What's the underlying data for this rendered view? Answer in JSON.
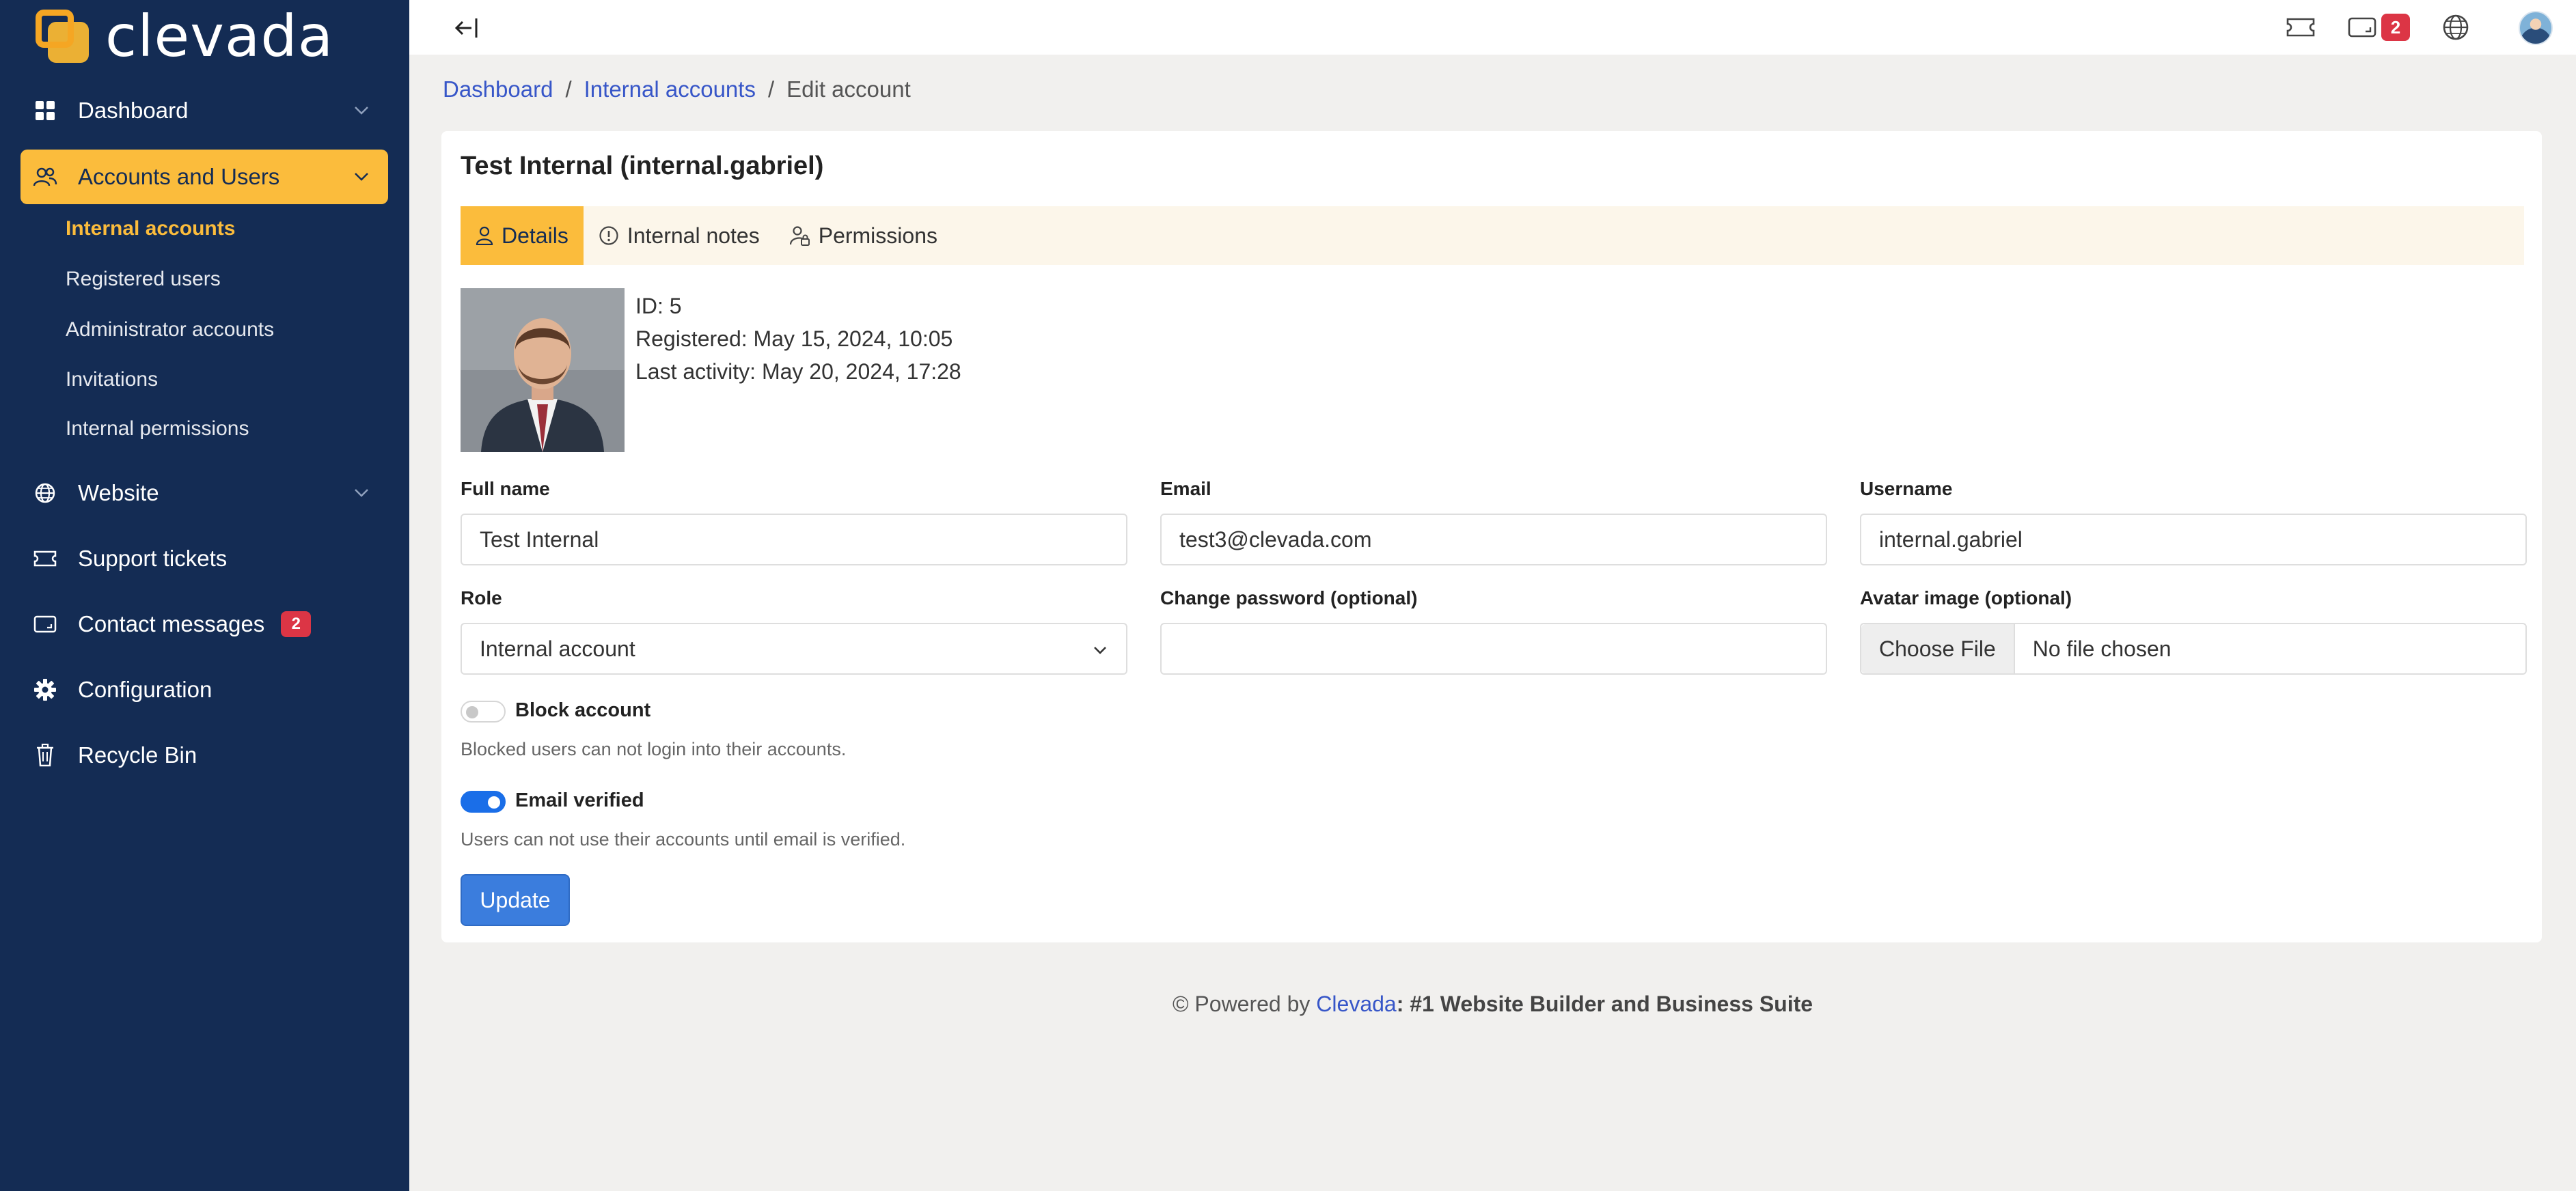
{
  "brand": {
    "name": "clevada"
  },
  "sidebar": {
    "items": [
      {
        "label": "Dashboard",
        "icon": "dashboard-grid-icon"
      },
      {
        "label": "Accounts and Users",
        "icon": "users-icon"
      },
      {
        "label": "Website",
        "icon": "globe-icon"
      },
      {
        "label": "Support tickets",
        "icon": "ticket-icon"
      },
      {
        "label": "Contact messages",
        "icon": "message-icon",
        "badge": "2"
      },
      {
        "label": "Configuration",
        "icon": "gear-icon"
      },
      {
        "label": "Recycle Bin",
        "icon": "trash-icon"
      }
    ],
    "subitems": [
      {
        "label": "Internal accounts"
      },
      {
        "label": "Registered users"
      },
      {
        "label": "Administrator accounts"
      },
      {
        "label": "Invitations"
      },
      {
        "label": "Internal permissions"
      }
    ]
  },
  "topbar": {
    "messages_badge": "2"
  },
  "breadcrumb": {
    "home": "Dashboard",
    "section": "Internal accounts",
    "current": "Edit account",
    "separator": "/"
  },
  "card": {
    "title": "Test Internal (internal.gabriel)",
    "tabs": [
      {
        "label": "Details"
      },
      {
        "label": "Internal notes"
      },
      {
        "label": "Permissions"
      }
    ],
    "meta": {
      "id": "ID: 5",
      "registered": "Registered: May 15, 2024, 10:05",
      "last_activity": "Last activity: May 20, 2024, 17:28"
    }
  },
  "form": {
    "full_name": {
      "label": "Full name",
      "value": "Test Internal"
    },
    "email": {
      "label": "Email",
      "value": "test3@clevada.com"
    },
    "username": {
      "label": "Username",
      "value": "internal.gabriel"
    },
    "role": {
      "label": "Role",
      "value": "Internal account"
    },
    "password": {
      "label": "Change password (optional)",
      "value": ""
    },
    "avatar": {
      "label": "Avatar image (optional)",
      "button": "Choose File",
      "status": "No file chosen"
    },
    "block": {
      "label": "Block account",
      "help": "Blocked users can not login into their accounts.",
      "checked": false
    },
    "verified": {
      "label": "Email verified",
      "help": "Users can not use their accounts until email is verified.",
      "checked": true
    },
    "submit": "Update"
  },
  "footer": {
    "prefix": "© Powered by",
    "brand": "Clevada",
    "tagline": ": #1 Website Builder and Business Suite"
  },
  "colors": {
    "sidebar": "#142c54",
    "accent": "#fbbc3c",
    "primary": "#3b7ddd",
    "link": "#3756c8",
    "badge": "#dc3545"
  }
}
